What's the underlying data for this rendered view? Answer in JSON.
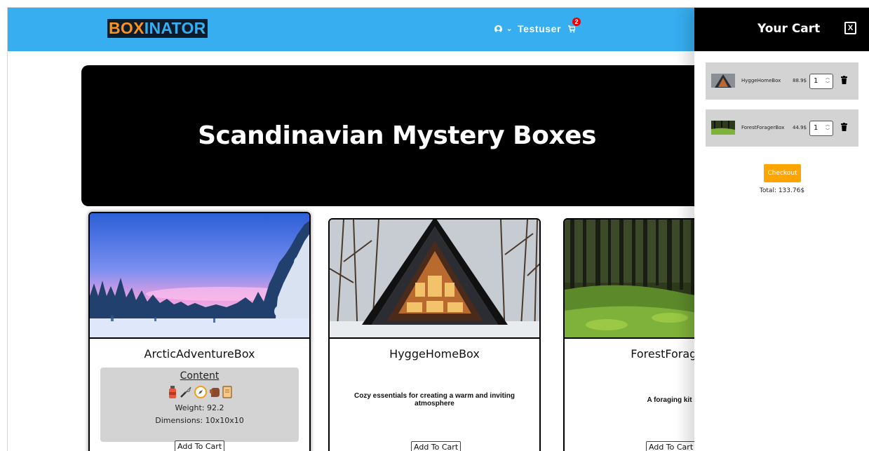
{
  "header": {
    "logo_part1": "BOX",
    "logo_part2": "INATOR",
    "username": "Testuser",
    "cart_count": "2"
  },
  "hero": {
    "title": "Scandinavian Mystery Boxes"
  },
  "products": [
    {
      "name": "ArcticAdventureBox",
      "content_label": "Content",
      "content_icons": [
        "bottle-icon",
        "knife-icon",
        "compass-icon",
        "glove-icon",
        "notebook-icon"
      ],
      "weight": "Weight: 92.2",
      "dimensions": "Dimensions: 10x10x10",
      "add_label": "Add To Cart"
    },
    {
      "name": "HyggeHomeBox",
      "description": "Cozy essentials for creating a warm and inviting atmosphere",
      "add_label": "Add To Cart"
    },
    {
      "name": "ForestForager",
      "description": "A foraging kit",
      "add_label": "Add To Cart"
    }
  ],
  "cart": {
    "title": "Your Cart",
    "close_label": "X",
    "items": [
      {
        "name": "HyggeHomeBox",
        "price": "88.9$",
        "qty": "1"
      },
      {
        "name": "ForestForagerBox",
        "price": "44.9$",
        "qty": "1"
      }
    ],
    "checkout_label": "Checkout",
    "total": "Total: 133.76$"
  },
  "colors": {
    "header_bg": "#36aef0",
    "logo_orange": "#f7931e",
    "checkout": "#ffa500",
    "badge": "#e00000"
  }
}
